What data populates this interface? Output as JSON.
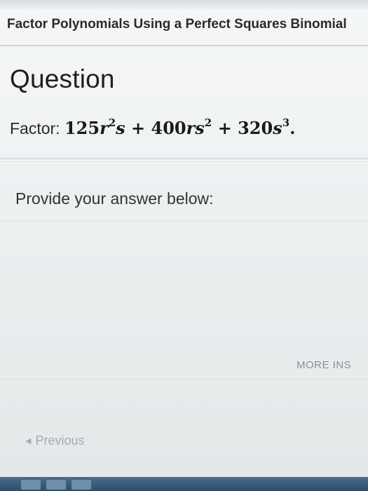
{
  "module": {
    "title": "Factor Polynomials Using a Perfect Squares Binomial"
  },
  "question": {
    "heading": "Question",
    "prompt_label": "Factor:",
    "expression": {
      "t1_coef": "125",
      "t1_var1": "r",
      "t1_exp1": "2",
      "t1_var2": "s",
      "op1": "+",
      "t2_coef": "400",
      "t2_var1": "r",
      "t2_var2": "s",
      "t2_exp2": "2",
      "op2": "+",
      "t3_coef": "320",
      "t3_var1": "s",
      "t3_exp1": "3",
      "end": "."
    },
    "answer_label": "Provide your answer below:"
  },
  "buttons": {
    "more": "MORE INS",
    "previous": "Previous"
  }
}
